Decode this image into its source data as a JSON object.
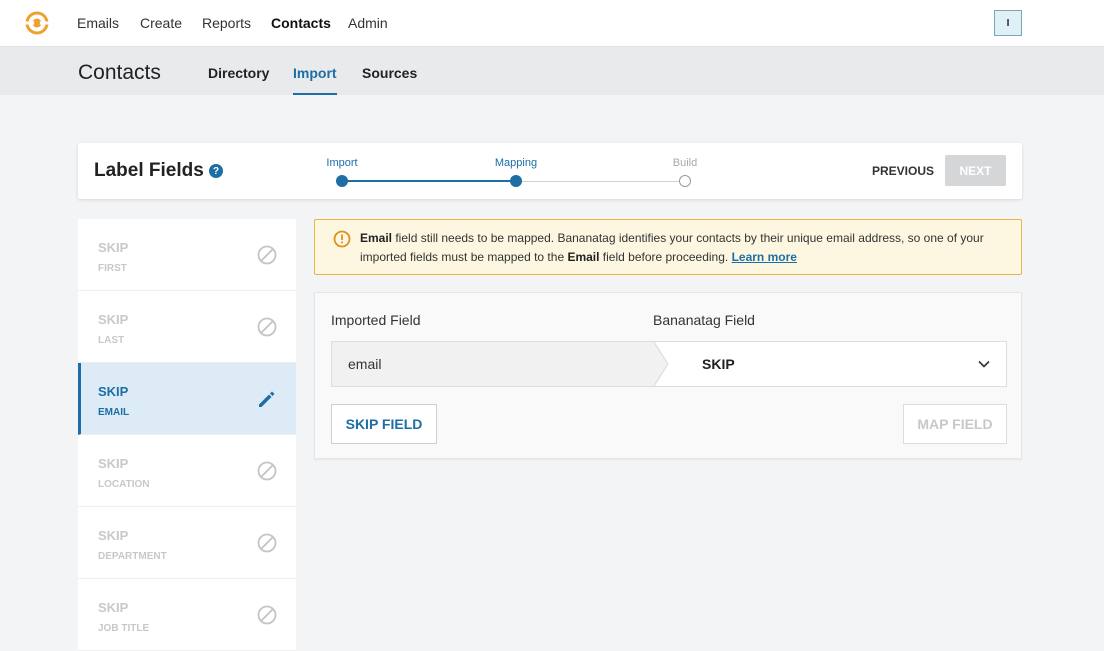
{
  "nav": {
    "items": [
      {
        "label": "Emails"
      },
      {
        "label": "Create"
      },
      {
        "label": "Reports"
      },
      {
        "label": "Contacts"
      },
      {
        "label": "Admin"
      }
    ],
    "active": "Contacts",
    "avatar_initial": "I"
  },
  "subheader": {
    "title": "Contacts",
    "tabs": [
      {
        "label": "Directory"
      },
      {
        "label": "Import"
      },
      {
        "label": "Sources"
      }
    ],
    "active_tab": "Import"
  },
  "wizard": {
    "title": "Label Fields",
    "help": "?",
    "steps": [
      {
        "label": "Import",
        "state": "done"
      },
      {
        "label": "Mapping",
        "state": "current"
      },
      {
        "label": "Build",
        "state": "pending"
      }
    ],
    "previous_label": "PREVIOUS",
    "next_label": "NEXT"
  },
  "fields": [
    {
      "main": "SKIP",
      "sub": "FIRST",
      "selected": false,
      "icon": "skip-icon"
    },
    {
      "main": "SKIP",
      "sub": "LAST",
      "selected": false,
      "icon": "skip-icon"
    },
    {
      "main": "SKIP",
      "sub": "EMAIL",
      "selected": true,
      "icon": "pencil-icon"
    },
    {
      "main": "SKIP",
      "sub": "LOCATION",
      "selected": false,
      "icon": "skip-icon"
    },
    {
      "main": "SKIP",
      "sub": "DEPARTMENT",
      "selected": false,
      "icon": "skip-icon"
    },
    {
      "main": "SKIP",
      "sub": "JOB TITLE",
      "selected": false,
      "icon": "skip-icon"
    }
  ],
  "warning": {
    "bold1": "Email",
    "text1": " field still needs to be mapped. Bananatag identifies your contacts by their unique email address, so one of your imported fields must be mapped to the ",
    "bold2": "Email",
    "text2": " field before proceeding. ",
    "link": "Learn more"
  },
  "mapping": {
    "imported_label": "Imported Field",
    "target_label": "Bananatag Field",
    "imported_value": "email",
    "target_value": "SKIP",
    "skip_button": "SKIP FIELD",
    "map_button": "MAP FIELD"
  },
  "colors": {
    "accent": "#1c6ea4",
    "warning_border": "#e6b64b",
    "warning_bg": "#fdf7e2",
    "logo": "#f0a030"
  }
}
